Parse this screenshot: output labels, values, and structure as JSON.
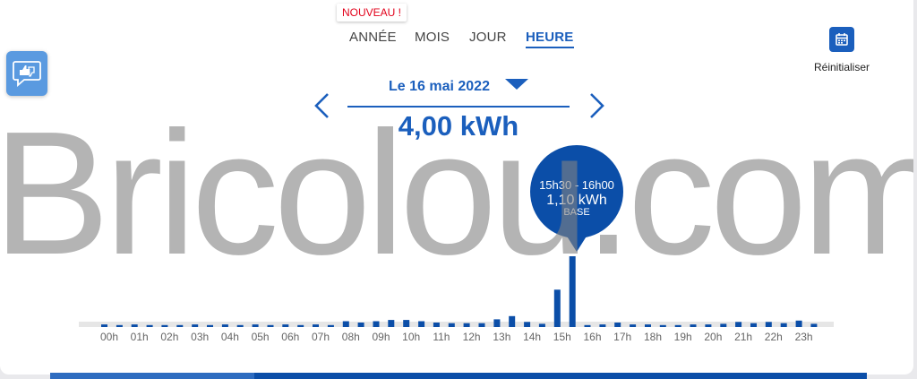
{
  "badge": {
    "label": "NOUVEAU !"
  },
  "tabs": [
    {
      "label": "ANNÉE",
      "active": false
    },
    {
      "label": "MOIS",
      "active": false
    },
    {
      "label": "JOUR",
      "active": false
    },
    {
      "label": "HEURE",
      "active": true
    }
  ],
  "reset": {
    "label": "Réinitialiser",
    "icon": "calendar-icon"
  },
  "feedback": {
    "icon": "thumbs-feedback-icon"
  },
  "date_selector": {
    "label": "Le 16 mai 2022",
    "icon": "caret-down-icon"
  },
  "total": {
    "value": "4,00 kWh"
  },
  "nav": {
    "prev_icon": "chevron-left-icon",
    "next_icon": "chevron-right-icon"
  },
  "tooltip": {
    "time_range": "15h30 - 16h00",
    "value": "1,10 kWh",
    "tariff": "BASE"
  },
  "watermark": {
    "text": "Bricolou.com"
  },
  "colors": {
    "accent": "#1b5fbd",
    "bar": "#0b4ea8",
    "watermark": "#828282"
  },
  "chart_data": {
    "type": "bar",
    "unit": "kWh",
    "x_labels": [
      "00h",
      "01h",
      "02h",
      "03h",
      "04h",
      "05h",
      "06h",
      "07h",
      "08h",
      "09h",
      "10h",
      "11h",
      "12h",
      "13h",
      "14h",
      "15h",
      "16h",
      "17h",
      "18h",
      "19h",
      "20h",
      "21h",
      "22h",
      "23h"
    ],
    "slot_minutes": 30,
    "values": [
      0.04,
      0.03,
      0.04,
      0.03,
      0.03,
      0.03,
      0.04,
      0.03,
      0.04,
      0.03,
      0.04,
      0.03,
      0.04,
      0.03,
      0.04,
      0.03,
      0.09,
      0.07,
      0.09,
      0.11,
      0.11,
      0.09,
      0.07,
      0.06,
      0.06,
      0.06,
      0.12,
      0.17,
      0.08,
      0.05,
      0.58,
      1.1,
      0.03,
      0.04,
      0.07,
      0.04,
      0.04,
      0.03,
      0.03,
      0.04,
      0.04,
      0.05,
      0.08,
      0.06,
      0.08,
      0.06,
      0.1,
      0.05
    ],
    "ylim": [
      0,
      1.3
    ],
    "highlighted_index": 31,
    "grid": false,
    "legend": "none"
  }
}
